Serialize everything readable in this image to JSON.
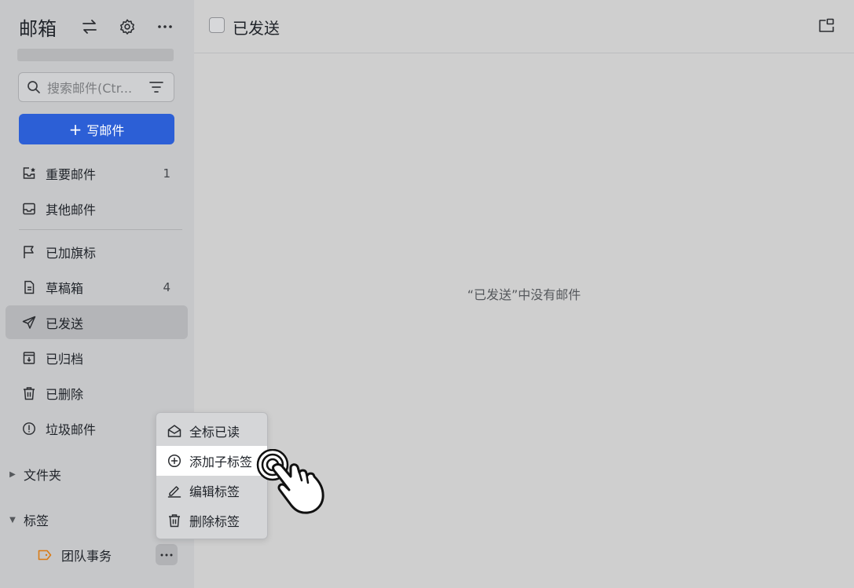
{
  "sidebar": {
    "title": "邮箱",
    "header_icons": [
      "switch-icon",
      "gear-icon",
      "more-icon"
    ],
    "search": {
      "placeholder": "搜索邮件(Ctr..."
    },
    "compose": {
      "plus": "+",
      "label": "写邮件"
    },
    "nav": [
      {
        "label": "重要邮件",
        "count": "1",
        "icon": "important-inbox-icon"
      },
      {
        "label": "其他邮件",
        "count": "",
        "icon": "inbox-icon"
      },
      {
        "label": "已加旗标",
        "count": "",
        "icon": "flag-icon"
      },
      {
        "label": "草稿箱",
        "count": "4",
        "icon": "draft-icon"
      },
      {
        "label": "已发送",
        "count": "",
        "icon": "send-icon",
        "active": true
      },
      {
        "label": "已归档",
        "count": "",
        "icon": "archive-icon"
      },
      {
        "label": "已删除",
        "count": "",
        "icon": "trash-icon"
      },
      {
        "label": "垃圾邮件",
        "count": "",
        "icon": "spam-icon"
      }
    ],
    "folders": {
      "label": "文件夹",
      "caret": "▶"
    },
    "tags": {
      "label": "标签",
      "caret": "▼"
    },
    "tag_items": [
      {
        "label": "团队事务",
        "color": "#d97b16"
      }
    ]
  },
  "context_menu": {
    "items": [
      {
        "label": "全标已读",
        "icon": "mail-open-icon"
      },
      {
        "label": "添加子标签",
        "icon": "add-circle-icon",
        "highlighted": true
      },
      {
        "label": "编辑标签",
        "icon": "edit-icon"
      },
      {
        "label": "删除标签",
        "icon": "trash-icon"
      }
    ]
  },
  "main": {
    "title": "已发送",
    "empty_text": "“已发送”中没有邮件"
  },
  "colors": {
    "accent": "#2c5fd6",
    "tag": "#d97b16"
  }
}
